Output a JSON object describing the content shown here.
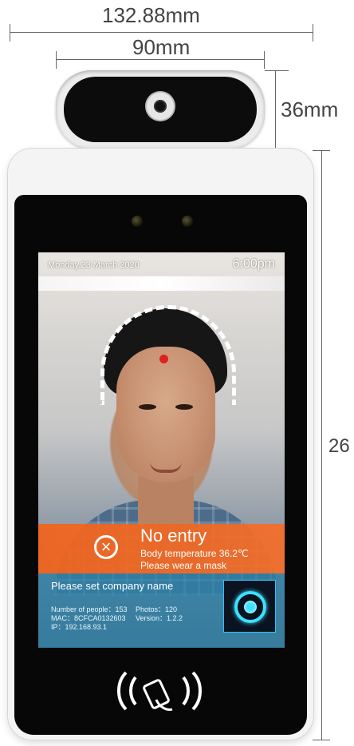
{
  "dimensions": {
    "outer_width": "132.88mm",
    "inner_width": "90mm",
    "camera_height": "36mm",
    "height_partial": "26"
  },
  "screen": {
    "date": "Monday,23 March 2020",
    "time": "6:00pm",
    "alert": {
      "title": "No entry",
      "line1": "Body temperature 36.2℃",
      "line2": "Please wear a mask",
      "color": "#f0641e"
    },
    "info": {
      "company": "Please set company name",
      "people": "Number of people：153",
      "photos": "Photos：120",
      "mac": "MAC：8CFCA0132603",
      "version": "Version：1.2.2",
      "ip": "IP：192.168.93.1"
    }
  },
  "icons": {
    "alert": "x-circle-icon",
    "qr": "qr-scan-icon",
    "nfc": "nfc-card-icon",
    "camera": "camera-lens-icon"
  }
}
